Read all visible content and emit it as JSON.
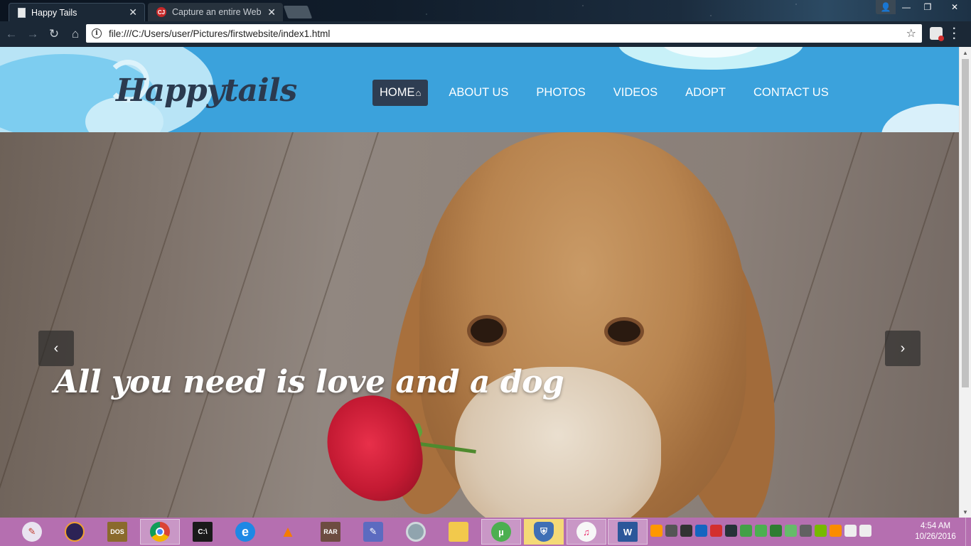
{
  "browser": {
    "tabs": [
      {
        "title": "Happy Tails",
        "active": true
      },
      {
        "title": "Capture an entire Web p",
        "active": false
      }
    ],
    "url": "file:///C:/Users/user/Pictures/firstwebsite/index1.html",
    "window_controls": {
      "minimize": "—",
      "restore": "❐",
      "close": "✕"
    }
  },
  "site": {
    "logo": "Happytails",
    "nav": [
      {
        "label": "HOME",
        "active": true
      },
      {
        "label": "ABOUT US"
      },
      {
        "label": "PHOTOS"
      },
      {
        "label": "VIDEOS"
      },
      {
        "label": "ADOPT"
      },
      {
        "label": "CONTACT US"
      }
    ],
    "hero": {
      "caption": "All you need is love and a dog",
      "prev_icon": "‹",
      "next_icon": "›"
    }
  },
  "taskbar": {
    "apps": [
      "paint-icon",
      "eclipse-icon",
      "dosbox-icon",
      "chrome-icon",
      "cmd-icon",
      "ie-icon",
      "vlc-icon",
      "winrar-icon",
      "photo-app-icon",
      "chrome-canary-icon",
      "file-explorer-icon",
      "utorrent-icon",
      "security-shield-icon",
      "itunes-icon",
      "word-icon"
    ],
    "clock_time": "4:54 AM",
    "clock_date": "10/26/2016"
  },
  "colors": {
    "header_bg": "#3ba2dc",
    "nav_active_bg": "#2e3d52",
    "logo": "#2b3a4f",
    "taskbar_bg": "#b56fb0"
  }
}
